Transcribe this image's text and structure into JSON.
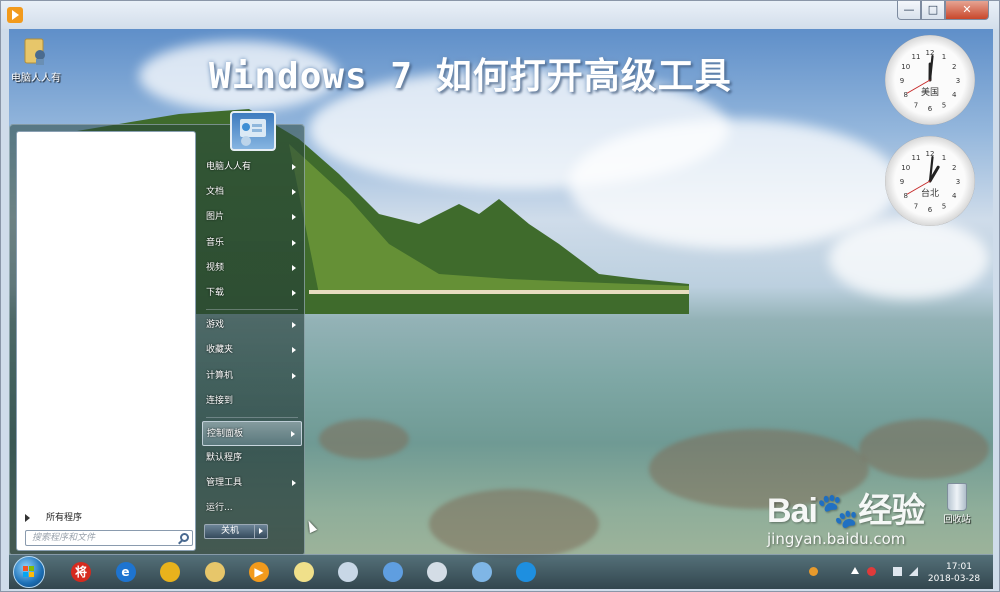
{
  "window": {
    "minimize_glyph": "—",
    "maximize_glyph": "□",
    "close_glyph": "✕"
  },
  "headline": "Windows 7 如何打开高级工具",
  "desktop_icons": [
    {
      "label": "电脑人人有"
    },
    {
      "label": "回收站"
    }
  ],
  "clocks": [
    {
      "city": "美国",
      "hour": 12,
      "minute": 1,
      "second": 40
    },
    {
      "city": "台北",
      "hour": 1,
      "minute": 1,
      "second": 40
    }
  ],
  "start_menu": {
    "all_programs": "所有程序",
    "search_placeholder": "搜索程序和文件",
    "right_items": [
      {
        "label": "电脑人人有",
        "has_submenu": true
      },
      {
        "label": "文档",
        "has_submenu": true
      },
      {
        "label": "图片",
        "has_submenu": true
      },
      {
        "label": "音乐",
        "has_submenu": true
      },
      {
        "label": "视频",
        "has_submenu": true
      },
      {
        "label": "下载",
        "has_submenu": true
      },
      {
        "label": "游戏",
        "has_submenu": true
      },
      {
        "label": "收藏夹",
        "has_submenu": true
      },
      {
        "label": "计算机",
        "has_submenu": true
      },
      {
        "label": "连接到",
        "has_submenu": false
      },
      {
        "label": "控制面板",
        "has_submenu": true
      },
      {
        "label": "默认程序",
        "has_submenu": false
      },
      {
        "label": "管理工具",
        "has_submenu": true
      },
      {
        "label": "运行...",
        "has_submenu": false
      }
    ],
    "active_item": "控制面板",
    "shutdown": "关机"
  },
  "watermark": {
    "brand": "Bai🐾经验",
    "url": "jingyan.baidu.com"
  },
  "taskbar": {
    "pinned_icons": [
      {
        "name": "jiang-app-icon",
        "glyph": "将",
        "color": "#d52a1e"
      },
      {
        "name": "ie-icon",
        "glyph": "e",
        "color": "#1e74d0"
      },
      {
        "name": "chrome-icon",
        "glyph": "",
        "color": "#e8b21c"
      },
      {
        "name": "folder-icon",
        "glyph": "",
        "color": "#e7c66a"
      },
      {
        "name": "media-player-icon",
        "glyph": "▶",
        "color": "#f29a1c"
      },
      {
        "name": "notes-icon",
        "glyph": "",
        "color": "#f0e08a"
      },
      {
        "name": "document-icon",
        "glyph": "",
        "color": "#c8d7e6"
      },
      {
        "name": "remote-desktop-icon",
        "glyph": "",
        "color": "#5f9ee0"
      },
      {
        "name": "paint-icon",
        "glyph": "",
        "color": "#d4dde6"
      },
      {
        "name": "network-icon",
        "glyph": "",
        "color": "#7fb6e6"
      },
      {
        "name": "browser-q-icon",
        "glyph": "",
        "color": "#1e8fe0"
      }
    ],
    "time": "17:01",
    "date": "2018-03-28"
  }
}
